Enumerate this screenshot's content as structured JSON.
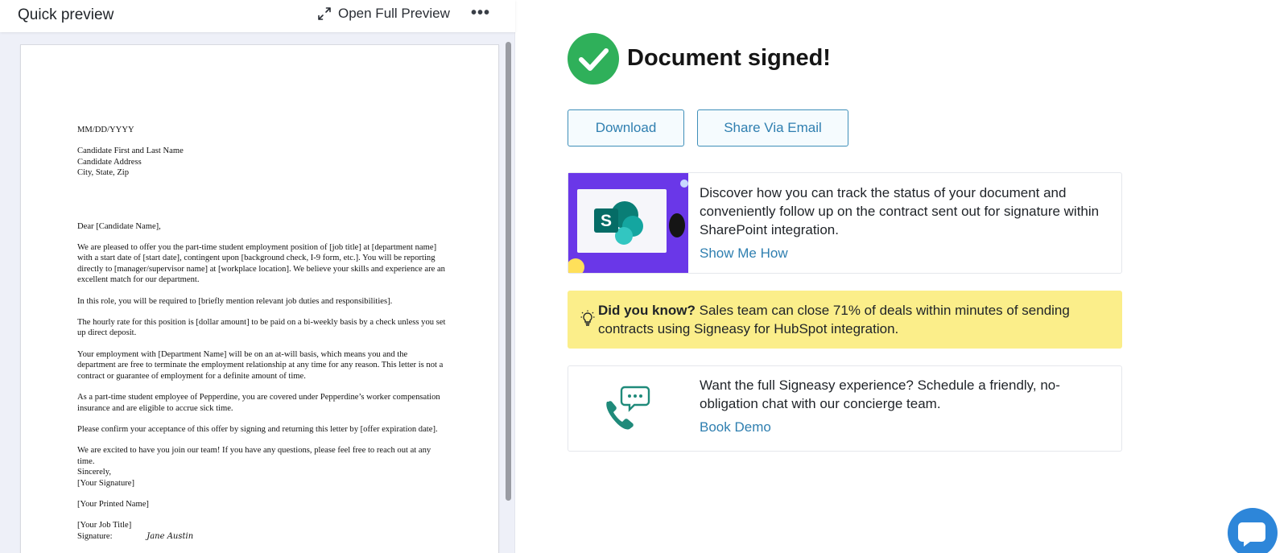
{
  "left_panel": {
    "title": "Quick preview",
    "open_full_preview_label": "Open Full Preview",
    "more_label": "•••"
  },
  "document": {
    "date": "MM/DD/YYYY",
    "address_lines": [
      "Candidate First and Last Name",
      "Candidate Address",
      "City, State, Zip"
    ],
    "salutation": "Dear [Candidate Name],",
    "paragraphs": [
      "We are pleased to offer you the part-time student employment position of [job title] at [department name] with a start date of [start date], contingent upon [background check, I-9 form, etc.]. You will be reporting directly to [manager/supervisor name] at [workplace location]. We believe your skills and experience are an excellent match for our department.",
      "In this role, you will be required to [briefly mention relevant job duties and responsibilities].",
      "The hourly rate for this position is [dollar amount] to be paid on a bi-weekly basis by a check unless you set up direct deposit.",
      "Your employment with [Department Name] will be on an at-will basis, which means you and the department are free to terminate the employment relationship at any time for any reason. This letter is not a contract or guarantee of employment for a definite amount of time.",
      "As a part-time student employee of Pepperdine, you are covered under Pepperdine’s worker compensation insurance and are eligible to accrue sick time.",
      "Please confirm your acceptance of this offer by signing and returning this letter by [offer expiration date].",
      "We are excited to have you join our team! If you have any questions, please feel free to reach out at any time."
    ],
    "closing": "Sincerely,",
    "your_signature": "[Your Signature]",
    "printed_name": "[Your Printed Name]",
    "job_title": "[Your Job Title]",
    "signature_label": "Signature:",
    "signature_scribble": "Jane Austin"
  },
  "status": {
    "title": "Document signed!"
  },
  "actions": {
    "download_label": "Download",
    "share_label": "Share Via Email"
  },
  "sharepoint_card": {
    "text": "Discover how you can track the status of your document and conveniently follow up on the contract sent out for signature within SharePoint integration.",
    "link": "Show Me How"
  },
  "tip": {
    "heading": "Did you know?",
    "text": "Sales team can close 71% of deals within minutes of sending contracts using Signeasy for HubSpot integration."
  },
  "demo_card": {
    "text": "Want the full Signeasy experience? Schedule a friendly, no-obligation chat with our concierge team.",
    "link": "Book Demo"
  },
  "icons": {
    "check": "check-circle-icon",
    "expand": "expand-icon",
    "more": "more-horizontal-icon",
    "sharepoint": "sharepoint-logo-icon",
    "lightbulb": "lightbulb-icon",
    "phone_chat": "phone-chat-icon",
    "chat_launcher": "chat-bubble-icon"
  },
  "colors": {
    "success_green": "#2fb05a",
    "link_blue": "#2f7fb0",
    "tip_yellow": "#fbee8a",
    "sharepoint_purple": "#6a37e8",
    "demo_teal": "#1f8a7a",
    "chat_blue": "#2d86d9"
  }
}
